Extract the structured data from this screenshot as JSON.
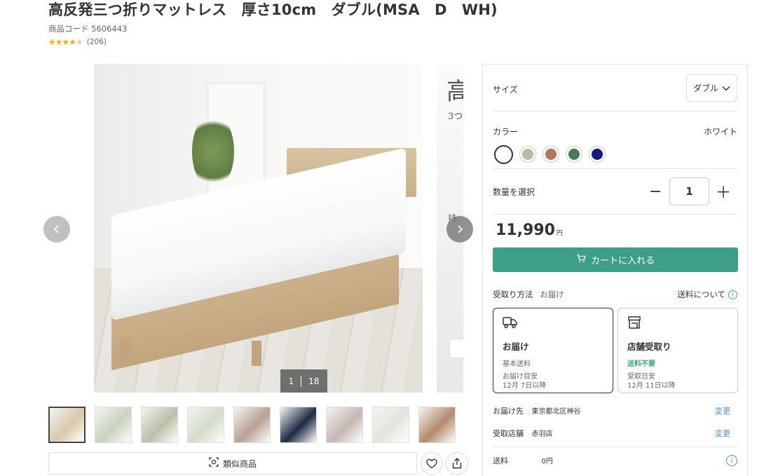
{
  "product": {
    "title": "高反発三つ折りマットレス　厚さ10cm　ダブル(MSA　D　WH)",
    "code_label": "商品コード",
    "code": "5606443",
    "stars": "★★★★",
    "star_half": "★",
    "review_count": "(206)",
    "rating_value": 4.5
  },
  "gallery": {
    "current": "1",
    "total": "18",
    "next_photo_title_char": "高",
    "next_photo_sub": "3つ",
    "next_photo_text": "持",
    "prev_icon": "chevron-left-icon",
    "next_icon": "chevron-right-icon",
    "thumbnail_count": 9,
    "thumbnail_colors": [
      "#d8c7ac",
      "#c9d3bf",
      "#b9c0a9",
      "#d4dcc9",
      "#b99f96",
      "#1f2a44",
      "#c5b6b2",
      "#e3e5dc",
      "#b48a6e"
    ]
  },
  "actions": {
    "similar_label": "類似商品",
    "similar_icon": "image-search-icon",
    "favorite_icon": "heart-icon",
    "share_icon": "share-icon"
  },
  "panel": {
    "size_label": "サイズ",
    "size_value": "ダブル",
    "color_label": "カラー",
    "color_value": "ホワイト",
    "colors": [
      "#ffffff",
      "#b7bba4",
      "#b0765b",
      "#4a7a58",
      "#121c7e"
    ],
    "quantity_label": "数量を選択",
    "quantity_value": "1",
    "minus": "−",
    "plus": "＋",
    "price": "11,990",
    "price_unit": "円",
    "cart_label": "カートに入れる",
    "accent_color": "#3e9f88",
    "receive_label": "受取り方法",
    "receive_value": "お届け",
    "shipping_link": "送料について",
    "delivery_card": {
      "title": "お届け",
      "fee": "基本送料",
      "date_label": "お届け目安",
      "date": "12月 7日以降"
    },
    "store_card": {
      "title": "店舗受取り",
      "fee": "送料不要",
      "date_label": "受取日安",
      "date": "12月 11日以降"
    },
    "address_label": "お届け先",
    "address_value": "東京都北区神谷",
    "store_label": "受取店舗",
    "store_value": "赤羽店",
    "change_label": "変更",
    "shipping_label": "送料",
    "shipping_value": "0円"
  }
}
